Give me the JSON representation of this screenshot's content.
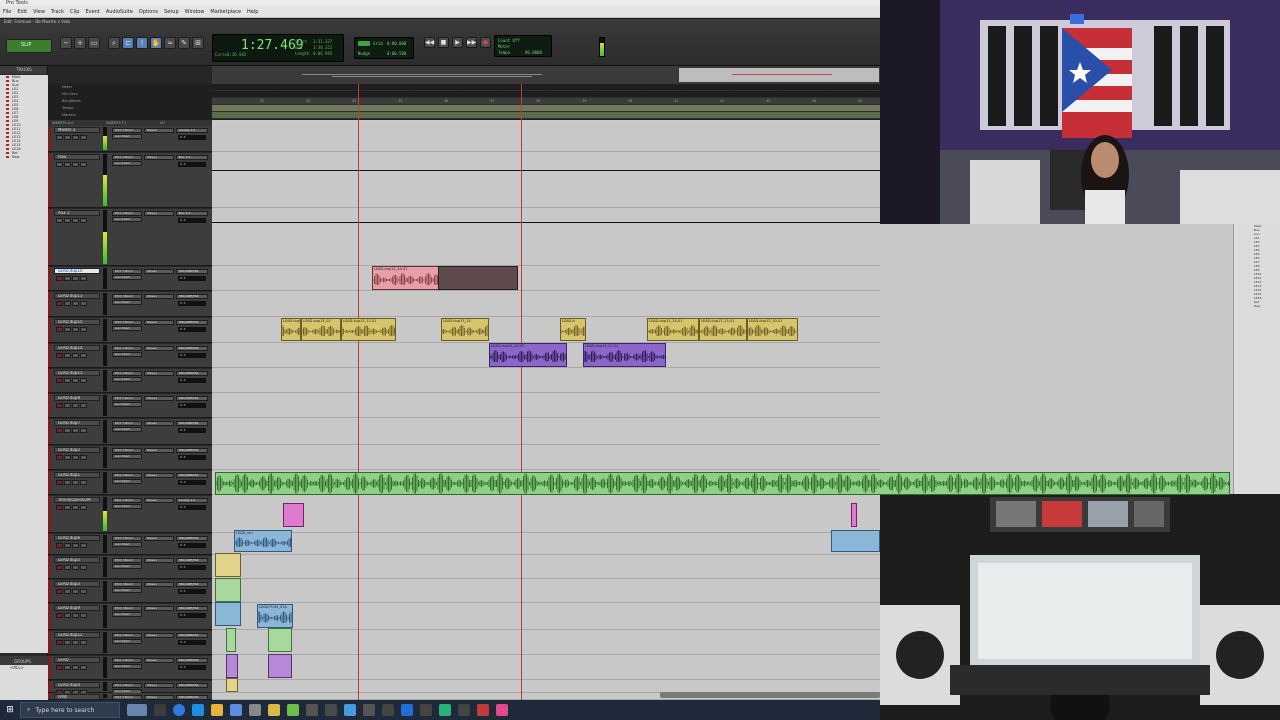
{
  "app": {
    "window_title": "Pro Tools",
    "edit_window_title": "Edit: Fromuse - De Muerte x Vida"
  },
  "menu": [
    "File",
    "Edit",
    "View",
    "Track",
    "Clip",
    "Event",
    "AudioSuite",
    "Options",
    "Setup",
    "Window",
    "Marketplace",
    "Help"
  ],
  "transport": {
    "main_counter": "1:27.469",
    "sub_labels": [
      "Start",
      "End",
      "Length",
      "Cursor"
    ],
    "sub_values": [
      "1:31.327",
      "1:38.322",
      "0:06.995",
      "1:36.982"
    ],
    "count_off": "Count Off",
    "meter": "Meter",
    "tempo": "Tempo",
    "tempo_value": "96.0000",
    "grid_label": "Grid",
    "nudge_label": "Nudge",
    "grid_value": "0:00.000",
    "nudge_value": "0:00.500",
    "mode_label": "SLIP"
  },
  "panels": {
    "tracks_title": "TRACKS",
    "groups_title": "GROUPS",
    "groups_item": "<ALL>"
  },
  "ruler_names": [
    "Meter",
    "Min:Secs",
    "Bars|Beats",
    "Tempo",
    "Markers"
  ],
  "header_columns": [
    "INSERTS A-E",
    "INSERTS F-J",
    "I/O"
  ],
  "track_list": [
    "Mast",
    "Bus",
    "Aux",
    "LE1",
    "LE2",
    "LE3",
    "LE4",
    "LE5",
    "LE6",
    "LE7",
    "LE8",
    "LE9",
    "LE10",
    "LE11",
    "LE12",
    "LE13",
    "LE14",
    "LE15",
    "LE16",
    "Ref",
    "Raw"
  ],
  "tracks": [
    {
      "name": "Master 2",
      "io": "Analog 1-2",
      "vol": "0.0",
      "kind": "master",
      "selected": false,
      "meter": true
    },
    {
      "name": "Raw",
      "io": "Bus 1-2",
      "vol": "0.0",
      "kind": "aux",
      "selected": false,
      "meter": true
    },
    {
      "name": "Aux 1",
      "io": "Bus 3-4",
      "vol": "0.0",
      "kind": "aux",
      "selected": false,
      "meter": true
    },
    {
      "name": "LEAD.dup10",
      "io": "MIC/LINE/HiZ",
      "vol": "0.0",
      "kind": "audio",
      "selected": true,
      "meter": false
    },
    {
      "name": "LEAD.dup13",
      "io": "MIC/LINE/HiZ",
      "vol": "0.0",
      "kind": "audio",
      "selected": false,
      "meter": false
    },
    {
      "name": "LEAD.dup15",
      "io": "MIC/LINE/HiZ",
      "vol": "0.0",
      "kind": "audio",
      "selected": false,
      "meter": false
    },
    {
      "name": "LEAD.dup14",
      "io": "MIC/LINE/HiZ",
      "vol": "0.0",
      "kind": "audio",
      "selected": false,
      "meter": false
    },
    {
      "name": "LEAD.dup11",
      "io": "MIC/LINE/HiZ",
      "vol": "0.0",
      "kind": "audio",
      "selected": false,
      "meter": false
    },
    {
      "name": "LEAD.dup8",
      "io": "MIC/LINE/HiZ",
      "vol": "0.0",
      "kind": "audio",
      "selected": false,
      "meter": false
    },
    {
      "name": "LEAD.dup7",
      "io": "MIC/LINE/HiZ",
      "vol": "0.0",
      "kind": "audio",
      "selected": false,
      "meter": false
    },
    {
      "name": "LEAD.dup2",
      "io": "MIC/LINE/HiZ",
      "vol": "0.0",
      "kind": "audio",
      "selected": false,
      "meter": false
    },
    {
      "name": "LEAD.dup1",
      "io": "MIC/LINE/HiZ",
      "vol": "0.0",
      "kind": "audio",
      "selected": false,
      "meter": false
    },
    {
      "name": "TrendyOpen02M",
      "io": "Analog 1-2",
      "vol": "0.0",
      "kind": "audio",
      "selected": false,
      "meter": true
    },
    {
      "name": "LEAD.dup6",
      "io": "MIC/LINE/HiZ",
      "vol": "0.0",
      "kind": "audio",
      "selected": false,
      "meter": false
    },
    {
      "name": "LEAD.dup5",
      "io": "MIC/LINE/HiZ",
      "vol": "0.0",
      "kind": "audio",
      "selected": false,
      "meter": false
    },
    {
      "name": "LEAD.dup3",
      "io": "MIC/LINE/HiZ",
      "vol": "0.0",
      "kind": "audio",
      "selected": false,
      "meter": false
    },
    {
      "name": "LEAD.dup9",
      "io": "MIC/LINE/HiZ",
      "vol": "0.0",
      "kind": "audio",
      "selected": false,
      "meter": false
    },
    {
      "name": "LEAD.dup12",
      "io": "MIC/LINE/HiZ",
      "vol": "0.0",
      "kind": "audio",
      "selected": false,
      "meter": false
    },
    {
      "name": "LEAD",
      "io": "MIC/LINE/HiZ",
      "vol": "0.0",
      "kind": "audio",
      "selected": false,
      "meter": false
    },
    {
      "name": "LEAD.dup4",
      "io": "MIC/LINE/HiZ",
      "vol": "0.0",
      "kind": "audio",
      "selected": false,
      "meter": false
    },
    {
      "name": "RAW",
      "io": "MIC/LINE/HiZ",
      "vol": "0.0",
      "kind": "audio",
      "selected": false,
      "meter": false
    }
  ],
  "insert_labels": {
    "a": "EQ3 7-Band",
    "b": "Aux Sham",
    "c": "Waves"
  },
  "ruler_ticks": [
    "32",
    "33",
    "34",
    "35",
    "36",
    "37",
    "38",
    "39",
    "40",
    "41",
    "42",
    "43",
    "44",
    "45",
    "46"
  ],
  "clips": [
    {
      "label": "LEAD.dup10_44-01",
      "color": "pink"
    },
    {
      "label": "LEAD.dup13",
      "color": "yellow"
    },
    {
      "label": "LEAD.dup13_02",
      "color": "yellow"
    },
    {
      "label": "LEAD.dup13_12-01",
      "color": "yellow"
    },
    {
      "label": "LEAD.dup13_14",
      "color": "yellow"
    },
    {
      "label": "LEAD.d",
      "color": "yellow"
    },
    {
      "label": "LEAD.dup13_24-01",
      "color": "yellow"
    },
    {
      "label": "LEAD.dup13_25-01",
      "color": "yellow"
    },
    {
      "label": "LEAD.dup13_30-01",
      "color": "yellow"
    },
    {
      "label": "LEAD.dup15_20-01",
      "color": "purple"
    },
    {
      "label": "LEAD.dup15_22-01",
      "color": "purple"
    },
    {
      "label": "LEAD_ctrl",
      "color": "blue"
    },
    {
      "label": "LEAD.Pl.tfa_01A",
      "color": "blue"
    }
  ],
  "taskbar": {
    "search_placeholder": "Type here to search"
  },
  "colors": {
    "playhead": "#c63a3a",
    "counter_green": "#7ee27e",
    "selected_track": "#1c50c0"
  }
}
